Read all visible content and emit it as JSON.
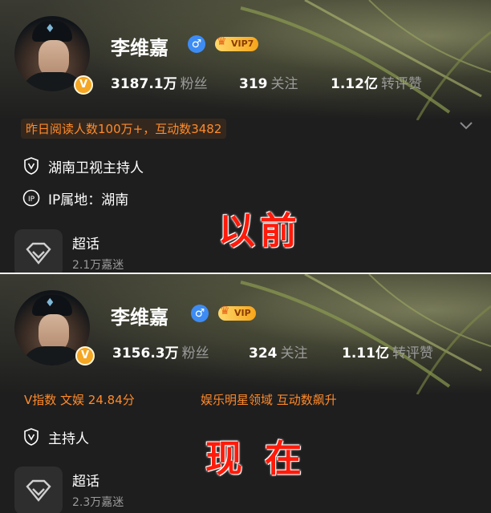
{
  "top": {
    "name": "李维嘉",
    "vip_label": "VIP7",
    "fans_count": "3187.1万",
    "fans_label": "粉丝",
    "following_count": "319",
    "following_label": "关注",
    "likes_count": "1.12亿",
    "likes_label": "转评赞",
    "highlight": "昨日阅读人数100万+，互动数3482",
    "role": "湖南卫视主持人",
    "ip_location": "IP属地：湖南",
    "super_topic_title": "超话",
    "super_topic_fans": "2.1万嘉迷",
    "overlay": "以前"
  },
  "bottom": {
    "name": "李维嘉",
    "vip_label": "VIP",
    "fans_count": "3156.3万",
    "fans_label": "粉丝",
    "following_count": "324",
    "following_label": "关注",
    "likes_count": "1.11亿",
    "likes_label": "转评赞",
    "v_index": "V指数 文娱 24.84分",
    "highlight": "娱乐明星领域 互动数飙升",
    "role": "主持人",
    "super_topic_title": "超话",
    "super_topic_fans": "2.3万嘉迷",
    "overlay": "现 在"
  },
  "icons": {
    "gender": "male-icon",
    "verified": "verified-v-icon",
    "crown": "crown-icon",
    "shield": "shield-v-icon",
    "ip": "ip-location-icon",
    "super_topic": "diamond-icon",
    "expand": "chevron-down-icon"
  },
  "colors": {
    "accent_orange": "#ff8a2a",
    "overlay_red": "#ff1a0a",
    "gender_blue": "#3d8cf5",
    "vip_gold": "#f6a51a"
  }
}
